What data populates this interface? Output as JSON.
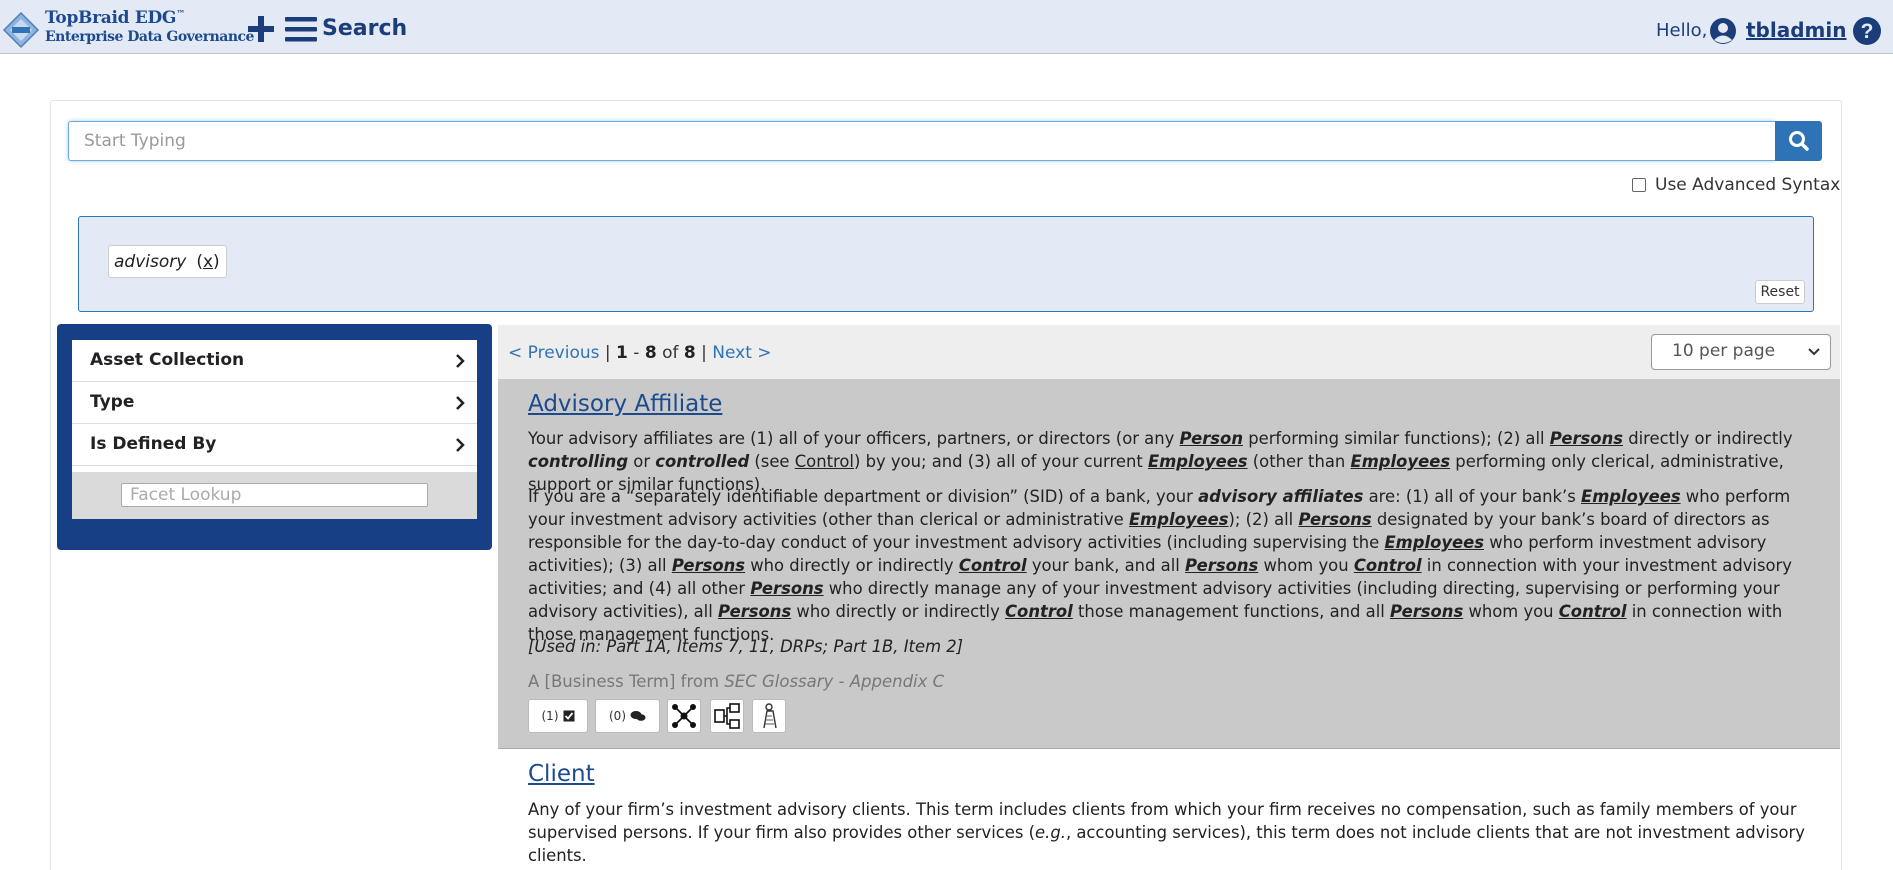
{
  "header": {
    "logo_line1": "TopBraid EDG",
    "logo_tm": "™",
    "logo_line2": "Enterprise Data Governance",
    "search_label": "Search",
    "hello": "Hello,",
    "username": "tbladmin"
  },
  "search": {
    "placeholder": "Start Typing",
    "advanced_syntax_label": "Use Advanced Syntax",
    "advanced_syntax_checked": false
  },
  "filters": {
    "chips": [
      {
        "term": "advisory",
        "remove": "x"
      }
    ],
    "reset_label": "Reset"
  },
  "facets": {
    "items": [
      {
        "label": "Asset Collection"
      },
      {
        "label": "Type"
      },
      {
        "label": "Is Defined By"
      }
    ],
    "lookup_placeholder": "Facet Lookup"
  },
  "pagination": {
    "prev": "< Previous",
    "sep": "|",
    "start": "1",
    "dash": "-",
    "end": "8",
    "of": "of",
    "total": "8",
    "next": "Next >",
    "per_page": "10 per page"
  },
  "results": [
    {
      "title": "Advisory Affiliate",
      "used_in": "[Used in: Part 1A, Items 7, 11, DRPs; Part 1B, Item 2]",
      "meta_prefix": "A [Business Term] from",
      "meta_source": "SEC Glossary - Appendix C",
      "tasks_count": "(1)",
      "comments_count": "(0)"
    },
    {
      "title": "Client"
    }
  ]
}
